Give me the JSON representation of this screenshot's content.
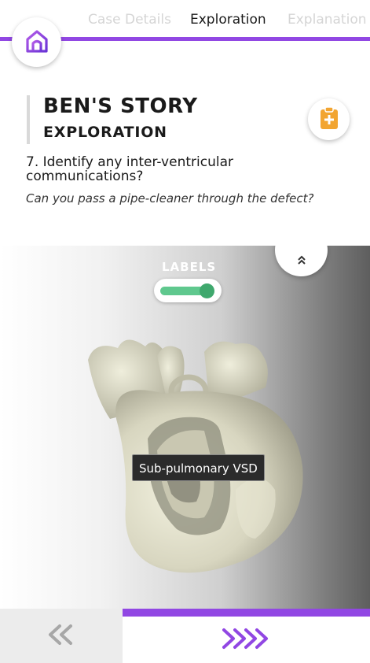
{
  "tabs": [
    {
      "label": "Case Details",
      "state": "inactive"
    },
    {
      "label": "Exploration",
      "state": "active"
    },
    {
      "label": "Explanation",
      "state": "inactive"
    }
  ],
  "header": {
    "title": "BEN'S STORY",
    "subtitle": "EXPLORATION"
  },
  "question": {
    "text": "7. Identify any inter-ventricular communications?",
    "prompt": "Can you pass a pipe-cleaner through the defect?"
  },
  "viewer": {
    "labels_title": "LABELS",
    "labels_enabled": true,
    "annotation": "Sub-pulmonary VSD"
  },
  "icons": {
    "home": "home-icon",
    "clipboard": "clipboard-plus-icon",
    "collapse": "chevron-double-up-icon",
    "back": "double-chevron-left-icon",
    "next": "quad-chevron-right-icon"
  },
  "colors": {
    "accent": "#9147e3",
    "toggle_on": "#5fc88e",
    "clipboard": "#f2a531"
  }
}
